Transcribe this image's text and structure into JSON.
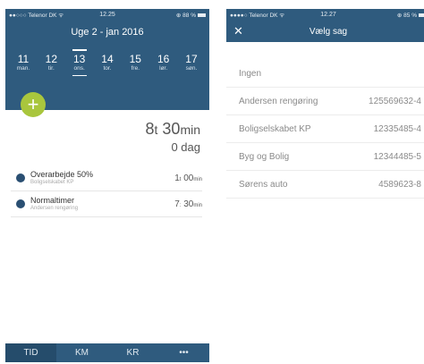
{
  "left": {
    "status": {
      "carrier": "●●○○○ Telenor DK ᯤ",
      "time": "12.25",
      "battery": "⊕ 88 %"
    },
    "week_title": "Uge 2 - jan 2016",
    "days": [
      {
        "num": "11",
        "label": "man."
      },
      {
        "num": "12",
        "label": "tir."
      },
      {
        "num": "13",
        "label": "ons."
      },
      {
        "num": "14",
        "label": "tor."
      },
      {
        "num": "15",
        "label": "fre."
      },
      {
        "num": "16",
        "label": "lør."
      },
      {
        "num": "17",
        "label": "søn."
      }
    ],
    "active_day_index": 2,
    "fab_icon": "plus-icon",
    "totals": {
      "hours": "8",
      "hours_unit": "t",
      "minutes": "30",
      "minutes_unit": "min",
      "days": "0 dag"
    },
    "entries": [
      {
        "title": "Overarbejde 50%",
        "subtitle": "Boligselskabet KP",
        "hours": "1",
        "hours_unit": "t",
        "minutes": "00",
        "minutes_unit": "min"
      },
      {
        "title": "Normaltimer",
        "subtitle": "Andersen rengøring",
        "hours": "7",
        "hours_unit": ":",
        "minutes": "30",
        "minutes_unit": "min"
      }
    ],
    "tabs": [
      "TID",
      "KM",
      "KR",
      "•••"
    ],
    "active_tab_index": 0
  },
  "right": {
    "status": {
      "carrier": "●●●●○ Telenor DK ᯤ",
      "time": "12.27",
      "battery": "⊕ 85 %"
    },
    "close_icon": "close-icon",
    "title": "Vælg sag",
    "options": [
      {
        "name": "Ingen",
        "code": ""
      },
      {
        "name": "Andersen rengøring",
        "code": "125569632-4"
      },
      {
        "name": "Boligselskabet KP",
        "code": "12335485-4"
      },
      {
        "name": "Byg og Bolig",
        "code": "12344485-5"
      },
      {
        "name": "Sørens auto",
        "code": "4589623-8"
      }
    ]
  },
  "colors": {
    "header": "#2f5b7e",
    "accent": "#a9c63d",
    "dot": "#2a4f72"
  }
}
